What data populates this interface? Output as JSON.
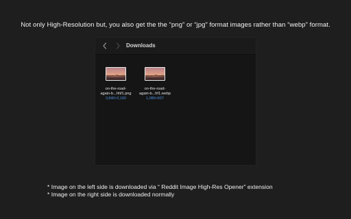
{
  "headline": "Not only High-Resolution but, you also get the the “png” or “jpg” format images rather than “webp” format.",
  "finder": {
    "folder_title": "Downloads",
    "back_icon": "chevron-left-icon",
    "forward_icon": "chevron-right-icon",
    "files": [
      {
        "name_line1": "on-the-road-",
        "name_line2": "again-b...hhf1.png",
        "dimensions": "3,840×2,160",
        "icon": "image-thumbnail-icon"
      },
      {
        "name_line1": "on-the-road-",
        "name_line2": "again-b...hf1.webp",
        "dimensions": "1,080×607",
        "icon": "image-thumbnail-icon"
      }
    ]
  },
  "notes": {
    "line1": "* Image on the left side is downloaded via “ Reddit Image High-Res Opener” extension",
    "line2": "* Image on the right side is downloaded normally"
  },
  "colors": {
    "background": "#1e1e1e",
    "window": "#151515",
    "dimension_text": "#4c8fe0"
  }
}
